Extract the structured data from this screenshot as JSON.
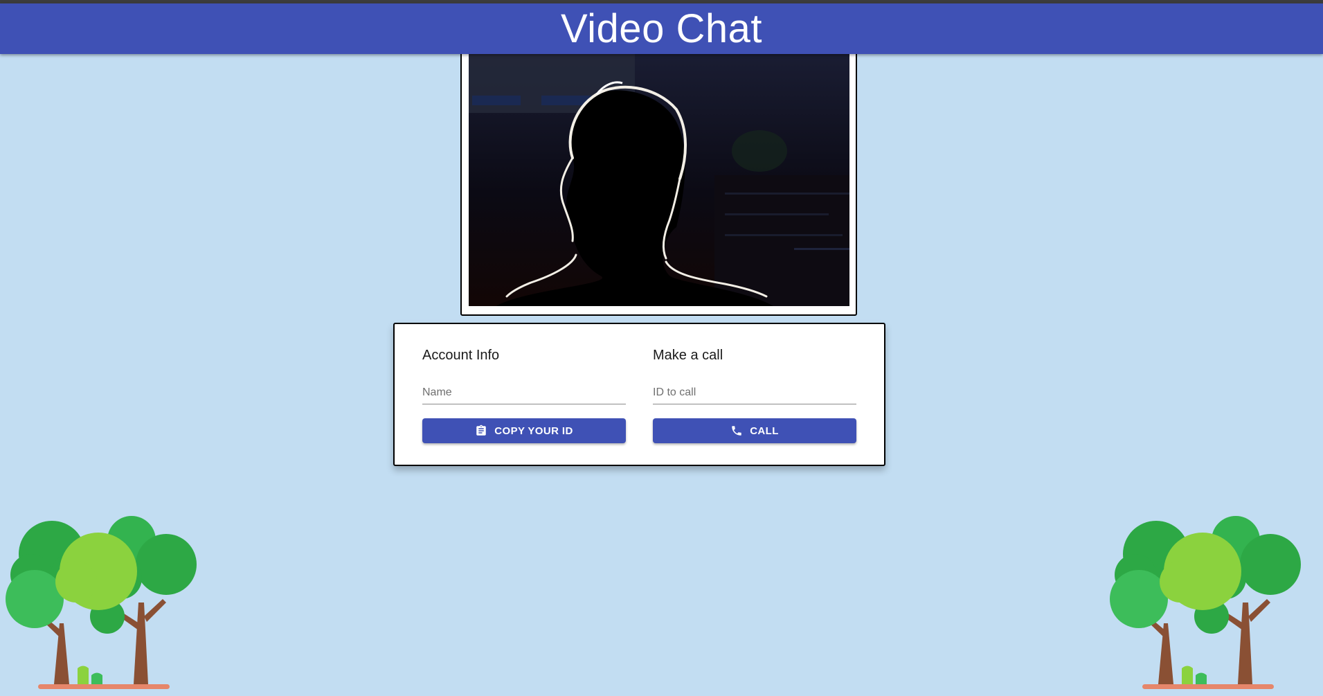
{
  "app": {
    "title": "Video Chat"
  },
  "video": {
    "description_icon": "webcam-video-feed"
  },
  "account": {
    "heading": "Account Info",
    "name_placeholder": "Name",
    "name_value": "",
    "copy_button_label": "COPY YOUR ID",
    "copy_icon": "clipboard-icon"
  },
  "call": {
    "heading": "Make a call",
    "id_placeholder": "ID to call",
    "id_value": "",
    "call_button_label": "CALL",
    "call_icon": "phone-icon"
  },
  "colors": {
    "primary": "#3f51b5",
    "background": "#c2ddf2",
    "white": "#ffffff"
  }
}
